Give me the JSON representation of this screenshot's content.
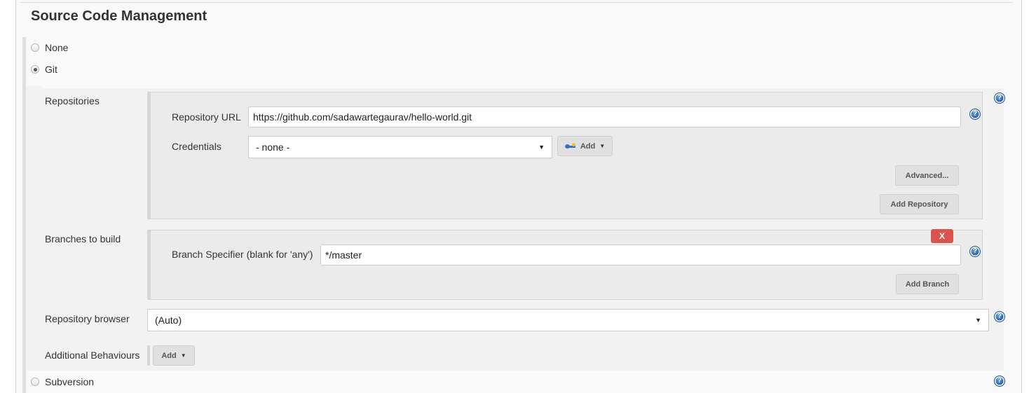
{
  "section": {
    "title": "Source Code Management"
  },
  "scm_options": [
    {
      "label": "None",
      "checked": false
    },
    {
      "label": "Git",
      "checked": true
    },
    {
      "label": "Subversion",
      "checked": false
    }
  ],
  "git": {
    "repositories": {
      "label": "Repositories",
      "url_label": "Repository URL",
      "url_value": "https://github.com/sadawartegaurav/hello-world.git",
      "credentials_label": "Credentials",
      "credentials_selected": "- none -",
      "credentials_add_label": "Add",
      "advanced_label": "Advanced...",
      "add_repository_label": "Add Repository"
    },
    "branches": {
      "label": "Branches to build",
      "delete_label": "X",
      "specifier_label": "Branch Specifier (blank for 'any')",
      "specifier_value": "*/master",
      "add_branch_label": "Add Branch"
    },
    "repository_browser": {
      "label": "Repository browser",
      "selected": "(Auto)"
    },
    "additional_behaviours": {
      "label": "Additional Behaviours",
      "add_label": "Add"
    }
  },
  "icons": {
    "help": "help-icon",
    "key": "key-icon",
    "dropdown": "caret-down-icon"
  },
  "colors": {
    "delete_button": "#d9534f",
    "help_icon": "#1f5aa6",
    "panel_bg": "#f2f2f2"
  }
}
